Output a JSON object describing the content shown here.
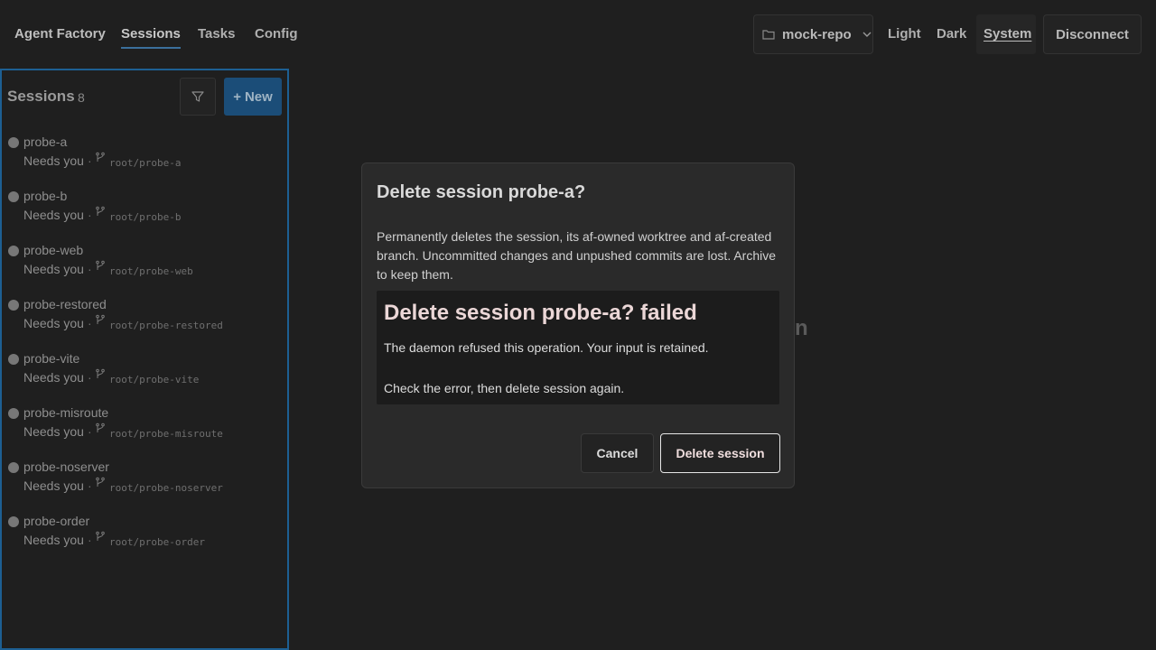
{
  "header": {
    "brand": "Agent Factory",
    "tabs": [
      {
        "label": "Sessions",
        "active": true
      },
      {
        "label": "Tasks",
        "active": false
      },
      {
        "label": "Config",
        "active": false
      }
    ],
    "repo": {
      "label": "mock-repo",
      "icon": "folder-icon"
    },
    "theme": {
      "options": [
        "Light",
        "Dark",
        "System"
      ],
      "selected": "System"
    },
    "disconnect_label": "Disconnect"
  },
  "sidebar": {
    "title": "Sessions",
    "count": "8",
    "new_label": "New",
    "sessions": [
      {
        "name": "probe-a",
        "status": "Needs you",
        "branch": "root/probe-a"
      },
      {
        "name": "probe-b",
        "status": "Needs you",
        "branch": "root/probe-b"
      },
      {
        "name": "probe-web",
        "status": "Needs you",
        "branch": "root/probe-web"
      },
      {
        "name": "probe-restored",
        "status": "Needs you",
        "branch": "root/probe-restored"
      },
      {
        "name": "probe-vite",
        "status": "Needs you",
        "branch": "root/probe-vite"
      },
      {
        "name": "probe-misroute",
        "status": "Needs you",
        "branch": "root/probe-misroute"
      },
      {
        "name": "probe-noserver",
        "status": "Needs you",
        "branch": "root/probe-noserver"
      },
      {
        "name": "probe-order",
        "status": "Needs you",
        "branch": "root/probe-order"
      }
    ]
  },
  "background": {
    "peek_text": "n"
  },
  "modal": {
    "title": "Delete session probe-a?",
    "description": "Permanently deletes the session, its af-owned worktree and af-created branch. Uncommitted changes and unpushed commits are lost. Archive to keep them.",
    "error": {
      "title": "Delete session probe-a? failed",
      "message": "The daemon refused this operation. Your input is retained.",
      "hint": "Check the error, then delete session again."
    },
    "cancel_label": "Cancel",
    "confirm_label": "Delete session"
  },
  "colors": {
    "background": "#1f1f1f",
    "accent": "#1d5f93",
    "modal_bg": "#2a2a2a",
    "error_bg": "#1c1c1c"
  }
}
